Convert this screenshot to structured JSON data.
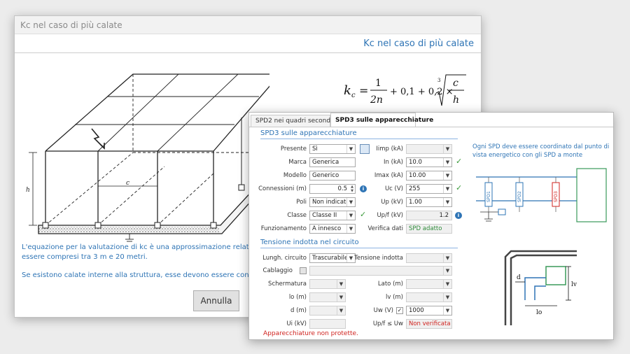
{
  "background_window": {
    "title": "Kc nel caso di più calate",
    "heading": "Kc nel caso di più calate",
    "formula": {
      "k": "k",
      "sub": "c",
      "num": "1",
      "den": "2n",
      "term2": "+ 0,1 + 0,2 ×",
      "root_index": "3",
      "c": "c",
      "h": "h"
    },
    "drawing_labels": {
      "c": "c",
      "h": "h"
    },
    "explanation": [
      "L'equazione per la valutazione di kc è una approssimazione relativa ai valori di c e h che devono",
      "essere compresi tra 3 m e 20 metri.",
      "Se esistono calate interne alla struttura, esse devono essere considerate nel valore di n."
    ],
    "cancel_label": "Annulla"
  },
  "dialog": {
    "tabs": [
      {
        "label": "SPD2 nei quadri secondari",
        "active": false
      },
      {
        "label": "SPD3 sulle apparecchiature",
        "active": true
      }
    ],
    "section1_title": "SPD3 sulle apparecchiature",
    "left_fields": [
      {
        "label": "Presente",
        "value": "Sì",
        "type": "select"
      },
      {
        "label": "Marca",
        "value": "Generica",
        "type": "text"
      },
      {
        "label": "Modello",
        "value": "Generico",
        "type": "text"
      },
      {
        "label": "Connessioni (m)",
        "value": "0.5",
        "type": "number"
      },
      {
        "label": "Poli",
        "value": "Non indicato",
        "type": "select"
      },
      {
        "label": "Classe",
        "value": "Classe II",
        "type": "select"
      },
      {
        "label": "Funzionamento",
        "value": "A innesco",
        "type": "select"
      }
    ],
    "right_fields": [
      {
        "label": "Iimp (kA)",
        "value": "",
        "type": "select"
      },
      {
        "label": "In (kA)",
        "value": "10.0",
        "type": "select"
      },
      {
        "label": "Imax (kA)",
        "value": "10.00",
        "type": "select"
      },
      {
        "label": "Uc (V)",
        "value": "255",
        "type": "select"
      },
      {
        "label": "Up (kV)",
        "value": "1.00",
        "type": "select"
      },
      {
        "label": "Up/f (kV)",
        "value": "1.2",
        "type": "text"
      },
      {
        "label": "Verifica dati",
        "value": "SPD adatto",
        "type": "text"
      }
    ],
    "note": "Ogni SPD deve essere coordinato dal punto di vista energetico con gli SPD a monte",
    "spd_labels": [
      "SPD1",
      "SPD2",
      "SPD3"
    ],
    "section2_title": "Tensione indotta nel circuito",
    "lungh_label": "Lungh. circuito",
    "lungh_value": "Trascurabile",
    "tensione_label": "Tensione indotta",
    "tensione_value": "",
    "cablaggio_label": "Cablaggio",
    "schermatura_label": "Schermatura",
    "lato_label": "Lato (m)",
    "lo_label": "lo (m)",
    "lv_label": "lv (m)",
    "d_label": "d (m)",
    "uw_label": "Uw (V)",
    "uw_value": "1000",
    "ui_label": "Ui (kV)",
    "upf_uw_label": "Up/f ≤ Uw",
    "upf_uw_value": "Non verificata",
    "diagram2_labels": {
      "d": "d",
      "lo": "lo",
      "lv": "lv"
    },
    "warning": "Apparecchiature non protette."
  },
  "colors": {
    "accent": "#2e74b5",
    "warning": "#d0231f",
    "ok": "#2e8b3a"
  }
}
